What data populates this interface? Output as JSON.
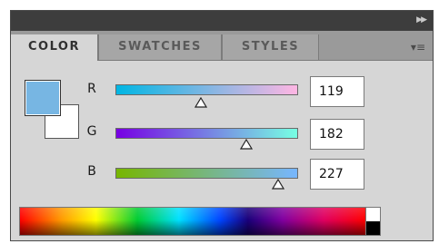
{
  "panel": {
    "tabs": [
      {
        "label": "COLOR",
        "active": true
      },
      {
        "label": "SWATCHES",
        "active": false
      },
      {
        "label": "STYLES",
        "active": false
      }
    ],
    "collapse_icon": "double-chevron-right-icon",
    "menu_icon": "panel-menu-icon"
  },
  "color": {
    "foreground": "#77b6e3",
    "background": "#ffffff",
    "channels": [
      {
        "label": "R",
        "value": "119",
        "level": 0.467,
        "gradient": [
          "#00b6e3",
          "#ffb6e3"
        ]
      },
      {
        "label": "G",
        "value": "182",
        "level": 0.714,
        "gradient": [
          "#7700e3",
          "#77ffe3"
        ]
      },
      {
        "label": "B",
        "value": "227",
        "level": 0.89,
        "gradient": [
          "#77b600",
          "#77b6ff"
        ]
      }
    ]
  }
}
